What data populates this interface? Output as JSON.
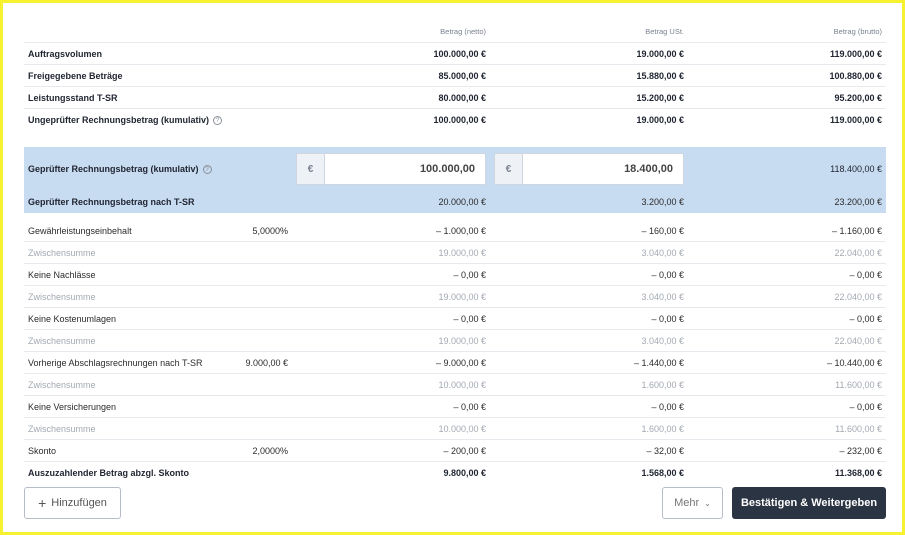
{
  "header": {
    "netto": "Betrag (netto)",
    "ust": "Betrag USt.",
    "brutto": "Betrag (brutto)"
  },
  "summary_rows": [
    {
      "label": "Auftragsvolumen",
      "netto": "100.000,00 €",
      "ust": "19.000,00 €",
      "brutto": "119.000,00 €"
    },
    {
      "label": "Freigegebene Beträge",
      "netto": "85.000,00 €",
      "ust": "15.880,00 €",
      "brutto": "100.880,00 €"
    },
    {
      "label": "Leistungsstand T-SR",
      "netto": "80.000,00 €",
      "ust": "15.200,00 €",
      "brutto": "95.200,00 €"
    },
    {
      "label": "Ungeprüfter Rechnungsbetrag (kumulativ)",
      "netto": "100.000,00 €",
      "ust": "19.000,00 €",
      "brutto": "119.000,00 €"
    }
  ],
  "help_glyph": "?",
  "checked": {
    "label": "Geprüfter Rechnungsbetrag (kumulativ)",
    "currency": "€",
    "netto_value": "100.000,00",
    "ust_value": "18.400,00",
    "brutto": "118.400,00 €"
  },
  "checked_tsr": {
    "label": "Geprüfter Rechnungsbetrag nach T-SR",
    "netto": "20.000,00 €",
    "ust": "3.200,00 €",
    "brutto": "23.200,00 €"
  },
  "deductions": [
    {
      "label": "Gewährleistungseinbehalt",
      "pct": "5,0000%",
      "netto": "– 1.000,00 €",
      "ust": "– 160,00 €",
      "brutto": "– 1.160,00 €"
    },
    {
      "label": "Zwischensumme",
      "pct": "",
      "netto": "19.000,00 €",
      "ust": "3.040,00 €",
      "brutto": "22.040,00 €",
      "sub": true
    },
    {
      "label": "Keine Nachlässe",
      "pct": "",
      "netto": "– 0,00 €",
      "ust": "– 0,00 €",
      "brutto": "– 0,00 €"
    },
    {
      "label": "Zwischensumme",
      "pct": "",
      "netto": "19.000,00 €",
      "ust": "3.040,00 €",
      "brutto": "22.040,00 €",
      "sub": true
    },
    {
      "label": "Keine Kostenumlagen",
      "pct": "",
      "netto": "– 0,00 €",
      "ust": "– 0,00 €",
      "brutto": "– 0,00 €"
    },
    {
      "label": "Zwischensumme",
      "pct": "",
      "netto": "19.000,00 €",
      "ust": "3.040,00 €",
      "brutto": "22.040,00 €",
      "sub": true
    },
    {
      "label": "Vorherige Abschlagsrechnungen nach T-SR",
      "pct": "9.000,00 €",
      "netto": "– 9.000,00 €",
      "ust": "– 1.440,00 €",
      "brutto": "– 10.440,00 €"
    },
    {
      "label": "Zwischensumme",
      "pct": "",
      "netto": "10.000,00 €",
      "ust": "1.600,00 €",
      "brutto": "11.600,00 €",
      "sub": true
    },
    {
      "label": "Keine Versicherungen",
      "pct": "",
      "netto": "– 0,00 €",
      "ust": "– 0,00 €",
      "brutto": "– 0,00 €"
    },
    {
      "label": "Zwischensumme",
      "pct": "",
      "netto": "10.000,00 €",
      "ust": "1.600,00 €",
      "brutto": "11.600,00 €",
      "sub": true
    },
    {
      "label": "Skonto",
      "pct": "2,0000%",
      "netto": "– 200,00 €",
      "ust": "– 32,00 €",
      "brutto": "– 232,00 €"
    }
  ],
  "payout": {
    "label": "Auszuzahlender Betrag abzgl. Skonto",
    "netto": "9.800,00 €",
    "ust": "1.568,00 €",
    "brutto": "11.368,00 €"
  },
  "footer": {
    "add_icon": "+",
    "add_label": "Hinzufügen",
    "more_label": "Mehr",
    "more_chevron": "⌄",
    "confirm_label": "Bestätigen & Weitergeben"
  }
}
